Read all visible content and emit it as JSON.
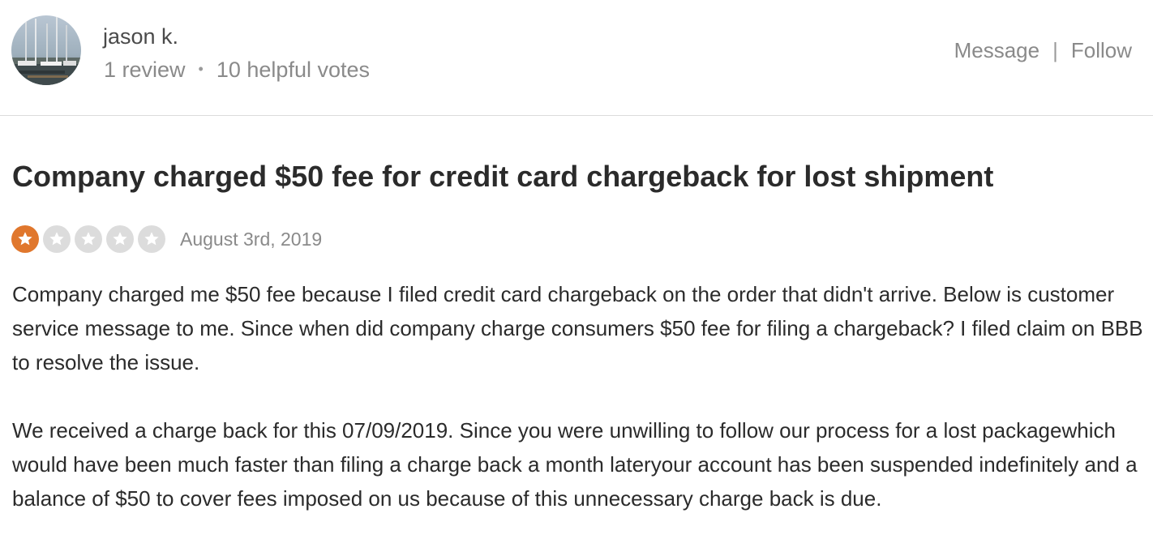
{
  "user": {
    "name": "jason k.",
    "reviews": "1 review",
    "separator": "•",
    "helpful_votes": "10 helpful votes",
    "avatar_icon": "avatar-photo"
  },
  "actions": {
    "message": "Message",
    "separator": "|",
    "follow": "Follow"
  },
  "review": {
    "title": "Company charged $50 fee for credit card chargeback for lost shipment",
    "rating": 1,
    "rating_max": 5,
    "date": "August 3rd, 2019",
    "paragraphs": [
      "Company charged me $50 fee because I filed credit card chargeback on the order that didn't arrive. Below is customer service message to me. Since when did company charge consumers $50 fee for filing a chargeback? I filed claim on BBB to resolve the issue.",
      "We received a charge back for this 07/09/2019. Since you were unwilling to follow our process for a lost packagewhich would have been much faster than filing a charge back a month lateryour account has been suspended indefinitely and a balance of $50 to cover fees imposed on us because of this unnecessary charge back is due."
    ]
  },
  "colors": {
    "star_active": "#e0772d",
    "star_inactive": "#dcdcdc"
  }
}
